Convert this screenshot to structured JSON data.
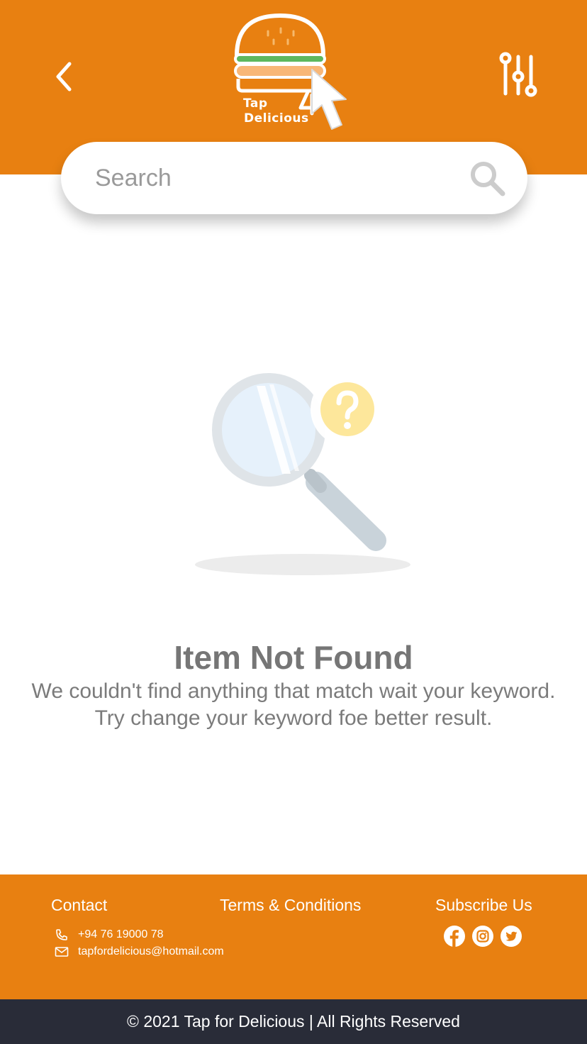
{
  "header": {
    "logo_line1": "Tap",
    "logo_line2": "Delicious",
    "brand_color": "#e88011",
    "icons": {
      "back": "chevron-left-icon",
      "filter": "sliders-icon"
    }
  },
  "search": {
    "placeholder": "Search",
    "value": "",
    "icon": "search-icon"
  },
  "empty_state": {
    "title": "Item Not Found",
    "message": "We couldn't find anything that match wait your keyword. Try change your keyword foe better result.",
    "illustration": "magnifier-question-illustration"
  },
  "footer": {
    "contact_heading": "Contact",
    "phone": "+94 76 19000 78",
    "email": "tapfordelicious@hotmail.com",
    "terms_link": "Terms & Conditions",
    "subscribe_heading": "Subscribe Us",
    "socials": [
      "facebook-icon",
      "instagram-icon",
      "twitter-icon"
    ]
  },
  "copyright": "© 2021 Tap for Delicious | All Rights Reserved",
  "colors": {
    "orange": "#e88011",
    "dark_bar": "#292c38",
    "text_gray": "#767676"
  }
}
